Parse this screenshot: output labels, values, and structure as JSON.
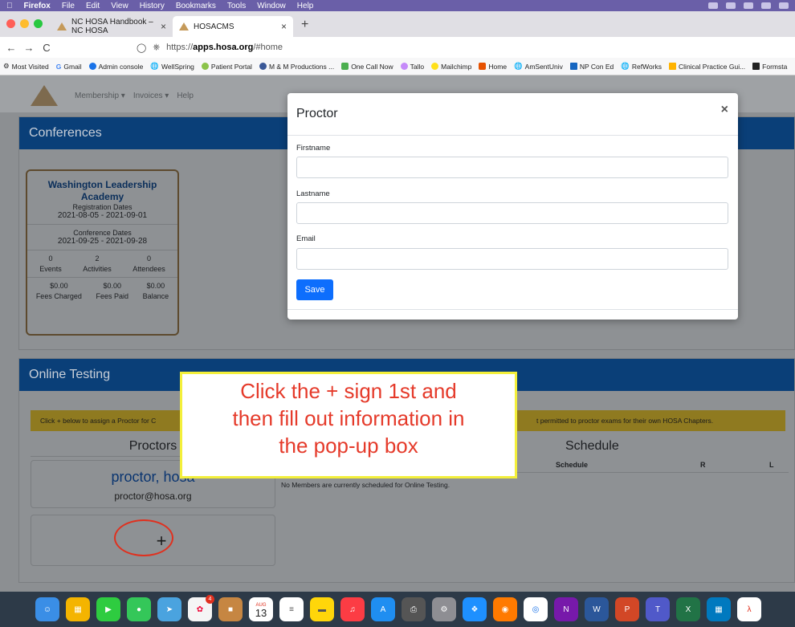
{
  "menubar": {
    "apple": "",
    "app_name": "Firefox",
    "items": [
      "File",
      "Edit",
      "View",
      "History",
      "Bookmarks",
      "Tools",
      "Window",
      "Help"
    ]
  },
  "tabs": [
    {
      "label": "NC HOSA Handbook – NC HOSA",
      "close": "×"
    },
    {
      "label": "HOSACMS",
      "close": "×"
    }
  ],
  "newtab": "+",
  "nav": {
    "back": "←",
    "forward": "→",
    "reload": "C",
    "url_prefix": "https://",
    "url_domain": "apps.hosa.org",
    "url_path": "/#home"
  },
  "bookmarks": [
    "Most Visited",
    "Gmail",
    "Admin console",
    "WellSpring",
    "Patient Portal",
    "M & M Productions ...",
    "One Call Now",
    "Tallo",
    "Mailchimp",
    "Home",
    "AmSentUniv",
    "NP Con Ed",
    "RefWorks",
    "Clinical Practice Gui...",
    "Formsta"
  ],
  "appnav": {
    "membership": "Membership ▾",
    "invoices": "Invoices ▾",
    "help": "Help"
  },
  "conferences": {
    "title": "Conferences",
    "card": {
      "name_line1": "Washington Leadership",
      "name_line2": "Academy",
      "reg_label": "Registration Dates",
      "reg_dates": "2021-08-05 - 2021-09-01",
      "conf_label": "Conference Dates",
      "conf_dates": "2021-09-25 - 2021-09-28",
      "stats": [
        {
          "value": "0",
          "label": "Events"
        },
        {
          "value": "2",
          "label": "Activities"
        },
        {
          "value": "0",
          "label": "Attendees"
        }
      ],
      "fees": [
        {
          "value": "$0.00",
          "label": "Fees Charged"
        },
        {
          "value": "$0.00",
          "label": "Fees Paid"
        },
        {
          "value": "$0.00",
          "label": "Balance"
        }
      ]
    }
  },
  "online_testing": {
    "title": "Online Testing",
    "alert_left": "Click + below to assign a Proctor for C",
    "alert_right": "t permitted to proctor exams for their own HOSA Chapters.",
    "proctors_title": "Proctors",
    "proctor_name": "proctor, hosa",
    "proctor_email": "proctor@hosa.org",
    "add": "+",
    "schedule_title": "Schedule",
    "columns": [
      "Schedule",
      "R",
      "L"
    ],
    "empty": "No Members are currently scheduled for Online Testing."
  },
  "callout": {
    "line1": "Click the + sign 1st and",
    "line2": "then fill out information in",
    "line3": "the pop-up box"
  },
  "modal": {
    "title": "Proctor",
    "close": "×",
    "firstname_label": "Firstname",
    "lastname_label": "Lastname",
    "email_label": "Email",
    "save": "Save"
  },
  "dock": {
    "calendar_month": "AUG",
    "calendar_day": "13",
    "photos_badge": "4"
  },
  "colors": {
    "accent_blue": "#0d6efd",
    "panel_header": "#0a3f78",
    "callout_text": "#e53a2a",
    "callout_border": "#f3ef3a",
    "ring": "#e0301e"
  }
}
